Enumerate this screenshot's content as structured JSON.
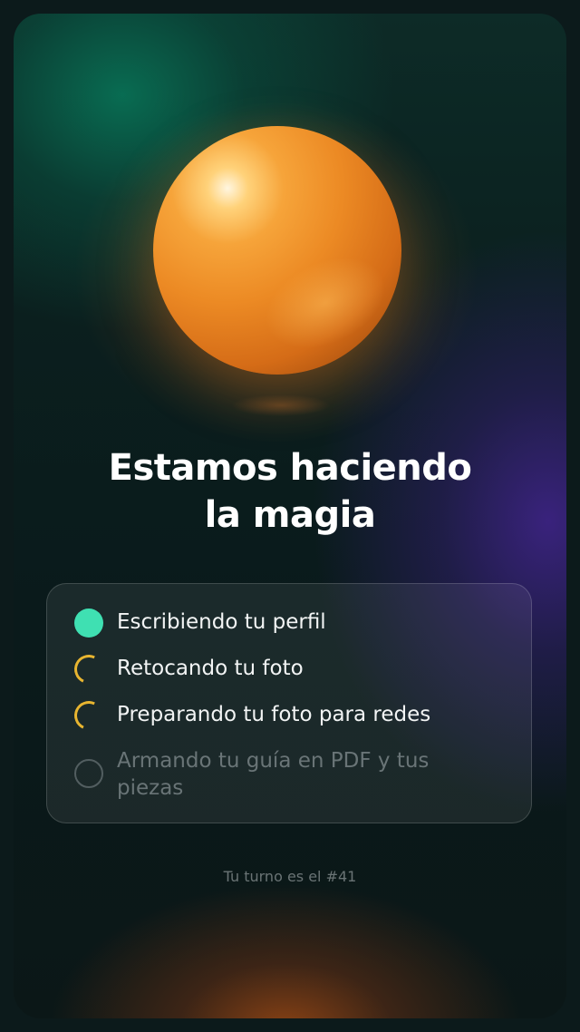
{
  "title": {
    "line1": "Estamos haciendo",
    "line2": "la magia"
  },
  "steps": [
    {
      "label": "Escribiendo tu perfil",
      "status": "done",
      "icon": "check-dot-icon"
    },
    {
      "label": "Retocando tu foto",
      "status": "loading",
      "icon": "spinner-icon"
    },
    {
      "label": "Preparando tu foto para redes",
      "status": "loading",
      "icon": "spinner-icon"
    },
    {
      "label": "Armando tu guía en PDF y tus piezas",
      "status": "pending",
      "icon": "empty-circle-icon"
    }
  ],
  "footer": {
    "queue_text": "Tu turno es el #41"
  },
  "colors": {
    "done": "#3fe0b2",
    "loading": "#e8b530",
    "orb": "#ec8a24"
  }
}
